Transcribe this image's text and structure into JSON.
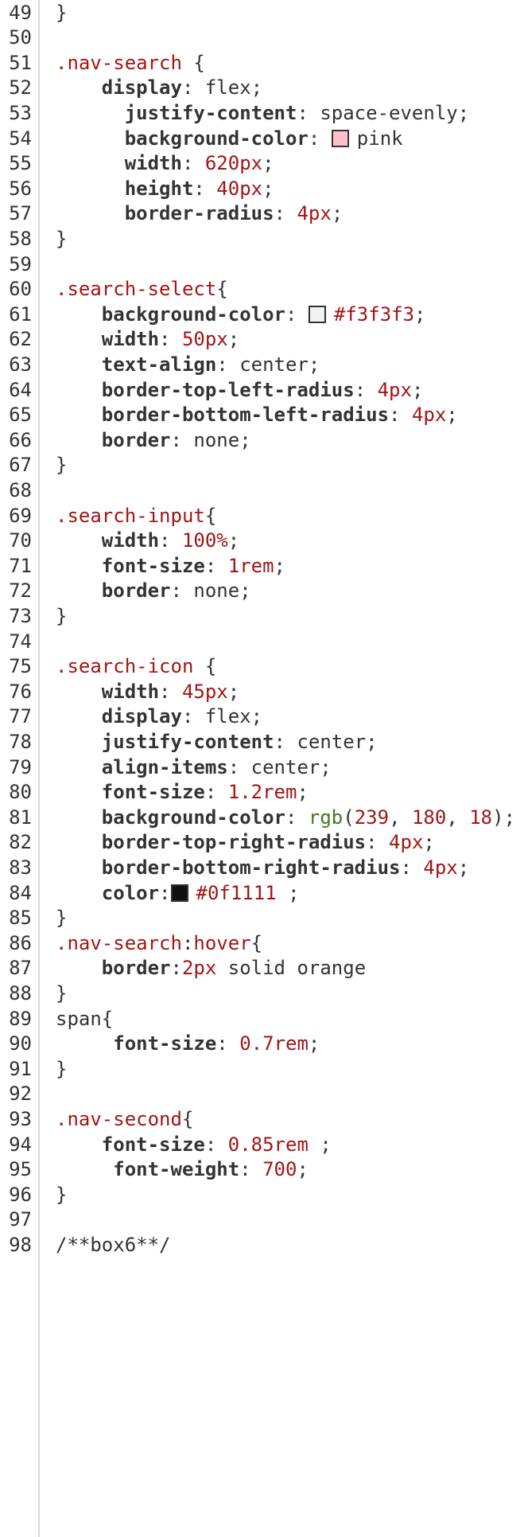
{
  "colors": {
    "selector": "#a31515",
    "number": "#a31515",
    "function": "#3a7d1c",
    "text": "#333333",
    "swatch_pink": "pink",
    "swatch_f3": "#f3f3f3",
    "swatch_0f": "#0f1111"
  },
  "lines": [
    {
      "n": "49",
      "segs": [
        {
          "c": "plain",
          "t": "}"
        }
      ]
    },
    {
      "n": "50",
      "segs": []
    },
    {
      "n": "51",
      "segs": [
        {
          "c": "sel",
          "t": ".nav-search"
        },
        {
          "c": "plain",
          "t": " {"
        }
      ]
    },
    {
      "n": "52",
      "segs": [
        {
          "c": "prop",
          "t": "    display"
        },
        {
          "c": "plain",
          "t": ": flex;"
        }
      ]
    },
    {
      "n": "53",
      "segs": [
        {
          "c": "prop",
          "t": "      justify-content"
        },
        {
          "c": "plain",
          "t": ": space-evenly;"
        }
      ]
    },
    {
      "n": "54",
      "segs": [
        {
          "c": "prop",
          "t": "      background-color"
        },
        {
          "c": "plain",
          "t": ": "
        },
        {
          "c": "swatch",
          "color": "pink"
        },
        {
          "c": "plain",
          "t": "pink"
        }
      ]
    },
    {
      "n": "55",
      "segs": [
        {
          "c": "prop",
          "t": "      width"
        },
        {
          "c": "plain",
          "t": ": "
        },
        {
          "c": "num",
          "t": "620px"
        },
        {
          "c": "plain",
          "t": ";"
        }
      ]
    },
    {
      "n": "56",
      "segs": [
        {
          "c": "prop",
          "t": "      height"
        },
        {
          "c": "plain",
          "t": ": "
        },
        {
          "c": "num",
          "t": "40px"
        },
        {
          "c": "plain",
          "t": ";"
        }
      ]
    },
    {
      "n": "57",
      "segs": [
        {
          "c": "prop",
          "t": "      border-radius"
        },
        {
          "c": "plain",
          "t": ": "
        },
        {
          "c": "num",
          "t": "4px"
        },
        {
          "c": "plain",
          "t": ";"
        }
      ]
    },
    {
      "n": "58",
      "segs": [
        {
          "c": "plain",
          "t": "}"
        }
      ]
    },
    {
      "n": "59",
      "segs": []
    },
    {
      "n": "60",
      "segs": [
        {
          "c": "sel",
          "t": ".search-select"
        },
        {
          "c": "plain",
          "t": "{"
        }
      ]
    },
    {
      "n": "61",
      "segs": [
        {
          "c": "prop",
          "t": "    background-color"
        },
        {
          "c": "plain",
          "t": ": "
        },
        {
          "c": "swatch",
          "color": "#f3f3f3"
        },
        {
          "c": "num",
          "t": "#f3f3f3"
        },
        {
          "c": "plain",
          "t": ";"
        }
      ]
    },
    {
      "n": "62",
      "segs": [
        {
          "c": "prop",
          "t": "    width"
        },
        {
          "c": "plain",
          "t": ": "
        },
        {
          "c": "num",
          "t": "50px"
        },
        {
          "c": "plain",
          "t": ";"
        }
      ]
    },
    {
      "n": "63",
      "segs": [
        {
          "c": "prop",
          "t": "    text-align"
        },
        {
          "c": "plain",
          "t": ": center;"
        }
      ]
    },
    {
      "n": "64",
      "segs": [
        {
          "c": "prop",
          "t": "    border-top-left-radius"
        },
        {
          "c": "plain",
          "t": ": "
        },
        {
          "c": "num",
          "t": "4px"
        },
        {
          "c": "plain",
          "t": ";"
        }
      ]
    },
    {
      "n": "65",
      "segs": [
        {
          "c": "prop",
          "t": "    border-bottom-left-radius"
        },
        {
          "c": "plain",
          "t": ": "
        },
        {
          "c": "num",
          "t": "4px"
        },
        {
          "c": "plain",
          "t": ";"
        }
      ]
    },
    {
      "n": "66",
      "segs": [
        {
          "c": "prop",
          "t": "    border"
        },
        {
          "c": "plain",
          "t": ": none;"
        }
      ]
    },
    {
      "n": "67",
      "segs": [
        {
          "c": "plain",
          "t": "}"
        }
      ]
    },
    {
      "n": "68",
      "segs": []
    },
    {
      "n": "69",
      "segs": [
        {
          "c": "sel",
          "t": ".search-input"
        },
        {
          "c": "plain",
          "t": "{"
        }
      ]
    },
    {
      "n": "70",
      "segs": [
        {
          "c": "prop",
          "t": "    width"
        },
        {
          "c": "plain",
          "t": ": "
        },
        {
          "c": "num",
          "t": "100%"
        },
        {
          "c": "plain",
          "t": ";"
        }
      ]
    },
    {
      "n": "71",
      "segs": [
        {
          "c": "prop",
          "t": "    font-size"
        },
        {
          "c": "plain",
          "t": ": "
        },
        {
          "c": "num",
          "t": "1rem"
        },
        {
          "c": "plain",
          "t": ";"
        }
      ]
    },
    {
      "n": "72",
      "segs": [
        {
          "c": "prop",
          "t": "    border"
        },
        {
          "c": "plain",
          "t": ": none;"
        }
      ]
    },
    {
      "n": "73",
      "segs": [
        {
          "c": "plain",
          "t": "}"
        }
      ]
    },
    {
      "n": "74",
      "segs": []
    },
    {
      "n": "75",
      "segs": [
        {
          "c": "sel",
          "t": ".search-icon"
        },
        {
          "c": "plain",
          "t": " {"
        }
      ]
    },
    {
      "n": "76",
      "segs": [
        {
          "c": "prop",
          "t": "    width"
        },
        {
          "c": "plain",
          "t": ": "
        },
        {
          "c": "num",
          "t": "45px"
        },
        {
          "c": "plain",
          "t": ";"
        }
      ]
    },
    {
      "n": "77",
      "segs": [
        {
          "c": "prop",
          "t": "    display"
        },
        {
          "c": "plain",
          "t": ": flex;"
        }
      ]
    },
    {
      "n": "78",
      "segs": [
        {
          "c": "prop",
          "t": "    justify-content"
        },
        {
          "c": "plain",
          "t": ": center;"
        }
      ]
    },
    {
      "n": "79",
      "segs": [
        {
          "c": "prop",
          "t": "    align-items"
        },
        {
          "c": "plain",
          "t": ": center;"
        }
      ]
    },
    {
      "n": "80",
      "segs": [
        {
          "c": "prop",
          "t": "    font-size"
        },
        {
          "c": "plain",
          "t": ": "
        },
        {
          "c": "num",
          "t": "1.2rem"
        },
        {
          "c": "plain",
          "t": ";"
        }
      ]
    },
    {
      "n": "81",
      "segs": [
        {
          "c": "prop",
          "t": "    background-color"
        },
        {
          "c": "plain",
          "t": ": "
        },
        {
          "c": "fn",
          "t": "rgb"
        },
        {
          "c": "plain",
          "t": "("
        },
        {
          "c": "num",
          "t": "239"
        },
        {
          "c": "plain",
          "t": ", "
        },
        {
          "c": "num",
          "t": "180"
        },
        {
          "c": "plain",
          "t": ", "
        },
        {
          "c": "num",
          "t": "18"
        },
        {
          "c": "plain",
          "t": ");"
        }
      ]
    },
    {
      "n": "82",
      "segs": [
        {
          "c": "prop",
          "t": "    border-top-right-radius"
        },
        {
          "c": "plain",
          "t": ": "
        },
        {
          "c": "num",
          "t": "4px"
        },
        {
          "c": "plain",
          "t": ";"
        }
      ]
    },
    {
      "n": "83",
      "segs": [
        {
          "c": "prop",
          "t": "    border-bottom-right-radius"
        },
        {
          "c": "plain",
          "t": ": "
        },
        {
          "c": "num",
          "t": "4px"
        },
        {
          "c": "plain",
          "t": ";"
        }
      ]
    },
    {
      "n": "84",
      "segs": [
        {
          "c": "prop",
          "t": "    color"
        },
        {
          "c": "plain",
          "t": ":"
        },
        {
          "c": "swatch",
          "color": "#0f1111"
        },
        {
          "c": "num",
          "t": "#0f1111"
        },
        {
          "c": "plain",
          "t": " ;"
        }
      ]
    },
    {
      "n": "85",
      "segs": [
        {
          "c": "plain",
          "t": "}"
        }
      ]
    },
    {
      "n": "86",
      "segs": [
        {
          "c": "sel",
          "t": ".nav-search"
        },
        {
          "c": "plain",
          "t": ":"
        },
        {
          "c": "sel",
          "t": "hover"
        },
        {
          "c": "plain",
          "t": "{"
        }
      ]
    },
    {
      "n": "87",
      "segs": [
        {
          "c": "prop",
          "t": "    border"
        },
        {
          "c": "plain",
          "t": ":"
        },
        {
          "c": "num",
          "t": "2px"
        },
        {
          "c": "plain",
          "t": " solid orange"
        }
      ]
    },
    {
      "n": "88",
      "segs": [
        {
          "c": "plain",
          "t": "}"
        }
      ]
    },
    {
      "n": "89",
      "segs": [
        {
          "c": "plain",
          "t": "span{"
        }
      ]
    },
    {
      "n": "90",
      "segs": [
        {
          "c": "prop",
          "t": "     font-size"
        },
        {
          "c": "plain",
          "t": ": "
        },
        {
          "c": "num",
          "t": "0.7rem"
        },
        {
          "c": "plain",
          "t": ";"
        }
      ]
    },
    {
      "n": "91",
      "segs": [
        {
          "c": "plain",
          "t": "}"
        }
      ]
    },
    {
      "n": "92",
      "segs": []
    },
    {
      "n": "93",
      "segs": [
        {
          "c": "sel",
          "t": ".nav-second"
        },
        {
          "c": "plain",
          "t": "{"
        }
      ]
    },
    {
      "n": "94",
      "segs": [
        {
          "c": "prop",
          "t": "    font-size"
        },
        {
          "c": "plain",
          "t": ": "
        },
        {
          "c": "num",
          "t": "0.85rem"
        },
        {
          "c": "plain",
          "t": " ;"
        }
      ]
    },
    {
      "n": "95",
      "segs": [
        {
          "c": "prop",
          "t": "     font-weight"
        },
        {
          "c": "plain",
          "t": ": "
        },
        {
          "c": "num",
          "t": "700"
        },
        {
          "c": "plain",
          "t": ";"
        }
      ]
    },
    {
      "n": "96",
      "segs": [
        {
          "c": "plain",
          "t": "}"
        }
      ]
    },
    {
      "n": "97",
      "segs": []
    },
    {
      "n": "98",
      "segs": [
        {
          "c": "plain",
          "t": "/**box6**/"
        }
      ]
    }
  ]
}
